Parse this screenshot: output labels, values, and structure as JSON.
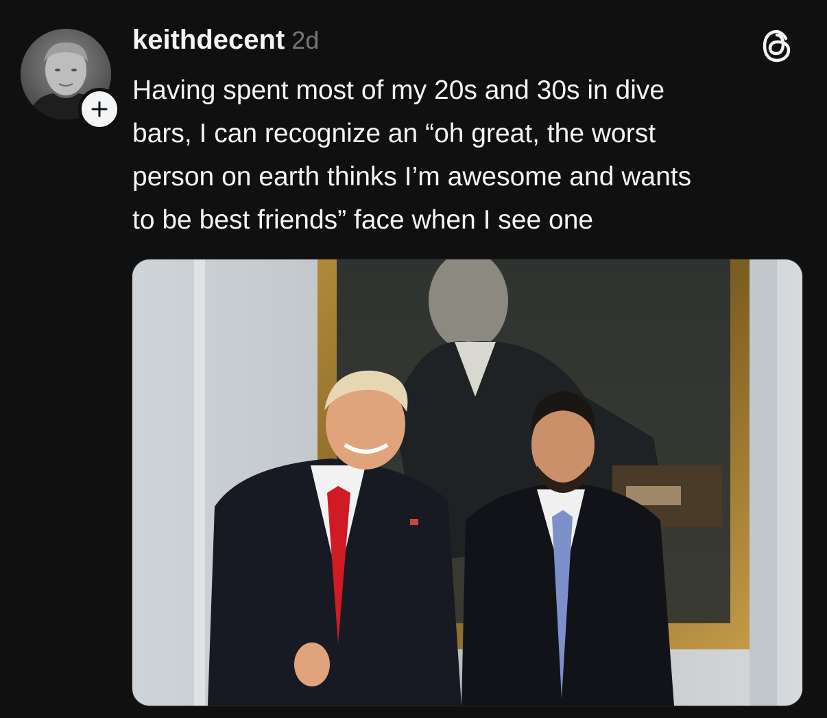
{
  "post": {
    "username": "keithdecent",
    "timestamp": "2d",
    "text_lines": [
      "Having spent most of my 20s and 30s in dive",
      "bars, I can recognize an “oh great, the worst",
      "person on earth thinks I’m awesome and wants",
      "to be best friends” face when I see one"
    ]
  },
  "icons": {
    "follow": "plus-icon",
    "brand": "threads-logo-icon"
  },
  "colors": {
    "background": "#101010",
    "text_primary": "#f3f5f7",
    "text_secondary": "#777777",
    "badge_background": "#f3f5f7"
  }
}
